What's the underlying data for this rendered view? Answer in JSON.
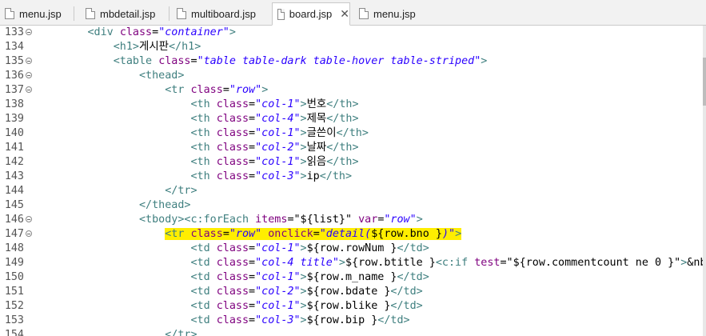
{
  "tabs": [
    {
      "label": "menu.jsp",
      "active": false
    },
    {
      "label": "mbdetail.jsp",
      "active": false
    },
    {
      "label": "multiboard.jsp",
      "active": false
    },
    {
      "label": "board.jsp",
      "active": true,
      "close": "✕"
    },
    {
      "label": "menu.jsp",
      "active": false
    }
  ],
  "lines": [
    {
      "n": "133",
      "fold": true,
      "indent": "        ",
      "parts": [
        {
          "c": "tag",
          "t": "<div "
        },
        {
          "c": "attr",
          "t": "class"
        },
        {
          "c": "txt",
          "t": "="
        },
        {
          "c": "str",
          "t": "\"container\""
        },
        {
          "c": "tag",
          "t": ">"
        }
      ]
    },
    {
      "n": "134",
      "fold": false,
      "indent": "            ",
      "parts": [
        {
          "c": "tag",
          "t": "<h1>"
        },
        {
          "c": "txt",
          "t": "게시판"
        },
        {
          "c": "tag",
          "t": "</h1>"
        }
      ]
    },
    {
      "n": "135",
      "fold": true,
      "indent": "            ",
      "parts": [
        {
          "c": "tag",
          "t": "<table "
        },
        {
          "c": "attr",
          "t": "class"
        },
        {
          "c": "txt",
          "t": "="
        },
        {
          "c": "str",
          "t": "\"table table-dark table-hover table-striped\""
        },
        {
          "c": "tag",
          "t": ">"
        }
      ]
    },
    {
      "n": "136",
      "fold": true,
      "indent": "                ",
      "parts": [
        {
          "c": "tag",
          "t": "<thead>"
        }
      ]
    },
    {
      "n": "137",
      "fold": true,
      "indent": "                    ",
      "parts": [
        {
          "c": "tag",
          "t": "<tr "
        },
        {
          "c": "attr",
          "t": "class"
        },
        {
          "c": "txt",
          "t": "="
        },
        {
          "c": "str",
          "t": "\"row\""
        },
        {
          "c": "tag",
          "t": ">"
        }
      ]
    },
    {
      "n": "138",
      "fold": false,
      "indent": "                        ",
      "parts": [
        {
          "c": "tag",
          "t": "<th "
        },
        {
          "c": "attr",
          "t": "class"
        },
        {
          "c": "txt",
          "t": "="
        },
        {
          "c": "str",
          "t": "\"col-1\""
        },
        {
          "c": "tag",
          "t": ">"
        },
        {
          "c": "txt",
          "t": "번호"
        },
        {
          "c": "tag",
          "t": "</th>"
        }
      ]
    },
    {
      "n": "139",
      "fold": false,
      "indent": "                        ",
      "parts": [
        {
          "c": "tag",
          "t": "<th "
        },
        {
          "c": "attr",
          "t": "class"
        },
        {
          "c": "txt",
          "t": "="
        },
        {
          "c": "str",
          "t": "\"col-4\""
        },
        {
          "c": "tag",
          "t": ">"
        },
        {
          "c": "txt",
          "t": "제목"
        },
        {
          "c": "tag",
          "t": "</th>"
        }
      ]
    },
    {
      "n": "140",
      "fold": false,
      "indent": "                        ",
      "parts": [
        {
          "c": "tag",
          "t": "<th "
        },
        {
          "c": "attr",
          "t": "class"
        },
        {
          "c": "txt",
          "t": "="
        },
        {
          "c": "str",
          "t": "\"col-1\""
        },
        {
          "c": "tag",
          "t": ">"
        },
        {
          "c": "txt",
          "t": "글쓴이"
        },
        {
          "c": "tag",
          "t": "</th>"
        }
      ]
    },
    {
      "n": "141",
      "fold": false,
      "indent": "                        ",
      "parts": [
        {
          "c": "tag",
          "t": "<th "
        },
        {
          "c": "attr",
          "t": "class"
        },
        {
          "c": "txt",
          "t": "="
        },
        {
          "c": "str",
          "t": "\"col-2\""
        },
        {
          "c": "tag",
          "t": ">"
        },
        {
          "c": "txt",
          "t": "날짜"
        },
        {
          "c": "tag",
          "t": "</th>"
        }
      ]
    },
    {
      "n": "142",
      "fold": false,
      "indent": "                        ",
      "parts": [
        {
          "c": "tag",
          "t": "<th "
        },
        {
          "c": "attr",
          "t": "class"
        },
        {
          "c": "txt",
          "t": "="
        },
        {
          "c": "str",
          "t": "\"col-1\""
        },
        {
          "c": "tag",
          "t": ">"
        },
        {
          "c": "txt",
          "t": "읽음"
        },
        {
          "c": "tag",
          "t": "</th>"
        }
      ]
    },
    {
      "n": "143",
      "fold": false,
      "indent": "                        ",
      "parts": [
        {
          "c": "tag",
          "t": "<th "
        },
        {
          "c": "attr",
          "t": "class"
        },
        {
          "c": "txt",
          "t": "="
        },
        {
          "c": "str",
          "t": "\"col-3\""
        },
        {
          "c": "tag",
          "t": ">"
        },
        {
          "c": "txt",
          "t": "ip"
        },
        {
          "c": "tag",
          "t": "</th>"
        }
      ]
    },
    {
      "n": "144",
      "fold": false,
      "indent": "                    ",
      "parts": [
        {
          "c": "tag",
          "t": "</tr>"
        }
      ]
    },
    {
      "n": "145",
      "fold": false,
      "indent": "                ",
      "parts": [
        {
          "c": "tag",
          "t": "</thead>"
        }
      ]
    },
    {
      "n": "146",
      "fold": true,
      "indent": "                ",
      "parts": [
        {
          "c": "tag",
          "t": "<tbody><c:forEach "
        },
        {
          "c": "attr",
          "t": "items"
        },
        {
          "c": "txt",
          "t": "="
        },
        {
          "c": "txt",
          "t": "\"${list}\""
        },
        {
          "c": "txt",
          "t": " "
        },
        {
          "c": "attr",
          "t": "var"
        },
        {
          "c": "txt",
          "t": "="
        },
        {
          "c": "str",
          "t": "\"row\""
        },
        {
          "c": "tag",
          "t": ">"
        }
      ]
    },
    {
      "n": "147",
      "fold": true,
      "highlight": true,
      "indent": "                    ",
      "parts": [
        {
          "c": "tag",
          "t": "<tr "
        },
        {
          "c": "attr",
          "t": "class"
        },
        {
          "c": "txt",
          "t": "="
        },
        {
          "c": "str",
          "t": "\"row\""
        },
        {
          "c": "txt",
          "t": " "
        },
        {
          "c": "attr",
          "t": "onclick"
        },
        {
          "c": "txt",
          "t": "="
        },
        {
          "c": "str",
          "t": "\"detail("
        },
        {
          "c": "txt",
          "t": "${row.bno }"
        },
        {
          "c": "str",
          "t": ")\""
        },
        {
          "c": "tag",
          "t": ">"
        }
      ]
    },
    {
      "n": "148",
      "fold": false,
      "indent": "                        ",
      "parts": [
        {
          "c": "tag",
          "t": "<td "
        },
        {
          "c": "attr",
          "t": "class"
        },
        {
          "c": "txt",
          "t": "="
        },
        {
          "c": "str",
          "t": "\"col-1\""
        },
        {
          "c": "tag",
          "t": ">"
        },
        {
          "c": "txt",
          "t": "${row.rowNum }"
        },
        {
          "c": "tag",
          "t": "</td>"
        }
      ]
    },
    {
      "n": "149",
      "fold": false,
      "indent": "                        ",
      "parts": [
        {
          "c": "tag",
          "t": "<td "
        },
        {
          "c": "attr",
          "t": "class"
        },
        {
          "c": "txt",
          "t": "="
        },
        {
          "c": "str",
          "t": "\"col-4 title\""
        },
        {
          "c": "tag",
          "t": ">"
        },
        {
          "c": "txt",
          "t": "${row.btitle }"
        },
        {
          "c": "tag",
          "t": "<c:if "
        },
        {
          "c": "attr",
          "t": "test"
        },
        {
          "c": "txt",
          "t": "="
        },
        {
          "c": "txt",
          "t": "\"${row.commentcount ne 0 }\""
        },
        {
          "c": "tag",
          "t": ">"
        },
        {
          "c": "txt",
          "t": "&nb"
        }
      ]
    },
    {
      "n": "150",
      "fold": false,
      "indent": "                        ",
      "parts": [
        {
          "c": "tag",
          "t": "<td "
        },
        {
          "c": "attr",
          "t": "class"
        },
        {
          "c": "txt",
          "t": "="
        },
        {
          "c": "str",
          "t": "\"col-1\""
        },
        {
          "c": "tag",
          "t": ">"
        },
        {
          "c": "txt",
          "t": "${row.m_name }"
        },
        {
          "c": "tag",
          "t": "</td>"
        }
      ]
    },
    {
      "n": "151",
      "fold": false,
      "indent": "                        ",
      "parts": [
        {
          "c": "tag",
          "t": "<td "
        },
        {
          "c": "attr",
          "t": "class"
        },
        {
          "c": "txt",
          "t": "="
        },
        {
          "c": "str",
          "t": "\"col-2\""
        },
        {
          "c": "tag",
          "t": ">"
        },
        {
          "c": "txt",
          "t": "${row.bdate }"
        },
        {
          "c": "tag",
          "t": "</td>"
        }
      ]
    },
    {
      "n": "152",
      "fold": false,
      "indent": "                        ",
      "parts": [
        {
          "c": "tag",
          "t": "<td "
        },
        {
          "c": "attr",
          "t": "class"
        },
        {
          "c": "txt",
          "t": "="
        },
        {
          "c": "str",
          "t": "\"col-1\""
        },
        {
          "c": "tag",
          "t": ">"
        },
        {
          "c": "txt",
          "t": "${row.blike }"
        },
        {
          "c": "tag",
          "t": "</td>"
        }
      ]
    },
    {
      "n": "153",
      "fold": false,
      "indent": "                        ",
      "parts": [
        {
          "c": "tag",
          "t": "<td "
        },
        {
          "c": "attr",
          "t": "class"
        },
        {
          "c": "txt",
          "t": "="
        },
        {
          "c": "str",
          "t": "\"col-3\""
        },
        {
          "c": "tag",
          "t": ">"
        },
        {
          "c": "txt",
          "t": "${row.bip }"
        },
        {
          "c": "tag",
          "t": "</td>"
        }
      ]
    },
    {
      "n": "154",
      "fold": false,
      "indent": "                    ",
      "parts": [
        {
          "c": "tag",
          "t": "</tr>"
        }
      ]
    }
  ]
}
